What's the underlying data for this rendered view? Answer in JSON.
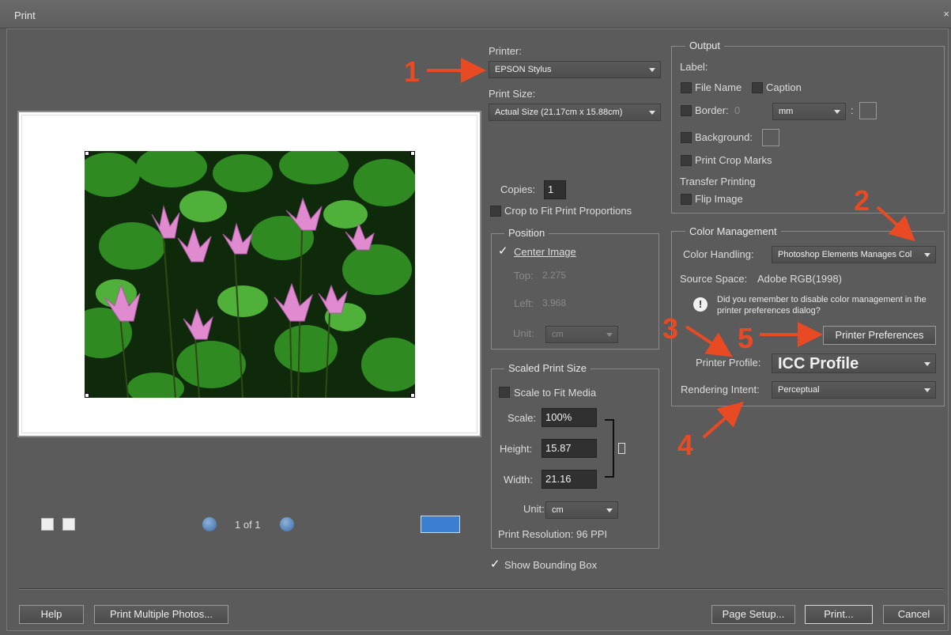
{
  "window": {
    "title": "Print",
    "close_glyph": "×"
  },
  "preview": {
    "page_indicator": "1 of 1"
  },
  "printer": {
    "label": "Printer:",
    "value": "EPSON Stylus"
  },
  "print_size": {
    "label": "Print Size:",
    "value": "Actual Size (21.17cm x 15.88cm)"
  },
  "copies": {
    "label": "Copies:",
    "value": "1"
  },
  "crop_to_fit": {
    "label": "Crop to Fit Print Proportions",
    "checked": false
  },
  "position": {
    "title": "Position",
    "center_image": {
      "label": "Center Image",
      "checked": true
    },
    "top": {
      "label": "Top:",
      "value": "2.275"
    },
    "left": {
      "label": "Left:",
      "value": "3.968"
    },
    "unit": {
      "label": "Unit:",
      "value": "cm"
    }
  },
  "scaled_print_size": {
    "title": "Scaled Print Size",
    "scale_to_fit": {
      "label": "Scale to Fit Media",
      "checked": false
    },
    "scale": {
      "label": "Scale:",
      "value": "100%"
    },
    "height": {
      "label": "Height:",
      "value": "15.87"
    },
    "width": {
      "label": "Width:",
      "value": "21.16"
    },
    "unit": {
      "label": "Unit:",
      "value": "cm"
    },
    "resolution": "Print Resolution: 96 PPI"
  },
  "show_bounding_box": {
    "label": "Show Bounding Box",
    "checked": true
  },
  "output": {
    "title": "Output",
    "label_heading": "Label:",
    "file_name": "File Name",
    "caption": "Caption",
    "border": {
      "label": "Border:",
      "value": "0",
      "unit": "mm",
      "sep": ":"
    },
    "background": "Background:",
    "print_crop_marks": "Print Crop Marks",
    "transfer_heading": "Transfer Printing",
    "flip_image": "Flip Image"
  },
  "color_management": {
    "title": "Color Management",
    "color_handling": {
      "label": "Color Handling:",
      "value": "Photoshop Elements Manages Col"
    },
    "source_space": {
      "label": "Source Space:",
      "value": "Adobe RGB(1998)"
    },
    "warning": "Did you remember to disable color management in the printer preferences dialog?",
    "printer_preferences": "Printer Preferences",
    "printer_profile": {
      "label": "Printer Profile:",
      "value": "ICC Profile"
    },
    "rendering_intent": {
      "label": "Rendering Intent:",
      "value": "Perceptual"
    }
  },
  "buttons": {
    "help": "Help",
    "print_multiple": "Print Multiple Photos...",
    "page_setup": "Page Setup...",
    "print": "Print...",
    "cancel": "Cancel"
  },
  "callouts": [
    "1",
    "2",
    "3",
    "4",
    "5"
  ],
  "colors": {
    "callout": "#e84a24",
    "background": "#5b5b5b"
  }
}
